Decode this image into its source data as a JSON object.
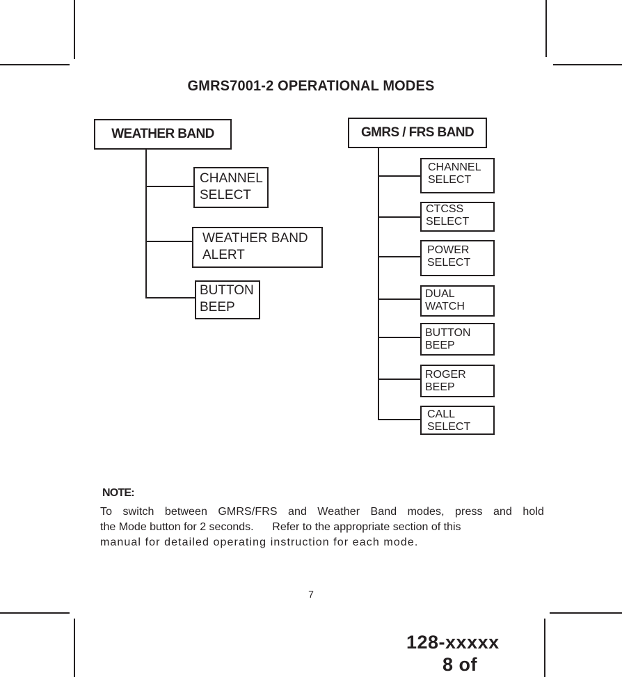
{
  "title": "GMRS7001-2 OPERATIONAL MODES",
  "weather_band": {
    "label": "WEATHER BAND",
    "children": [
      {
        "label": "CHANNEL\nSELECT"
      },
      {
        "label": "WEATHER BAND\nALERT"
      },
      {
        "label": "BUTTON\nBEEP"
      }
    ]
  },
  "gmrs_frs_band": {
    "label": "GMRS / FRS BAND",
    "children": [
      {
        "label": "CHANNEL\nSELECT"
      },
      {
        "label": "CTCSS\nSELECT"
      },
      {
        "label": "POWER\nSELECT"
      },
      {
        "label": "DUAL\nWATCH"
      },
      {
        "label": "BUTTON\nBEEP"
      },
      {
        "label": "ROGER\nBEEP"
      },
      {
        "label": "CALL\nSELECT"
      }
    ]
  },
  "note": {
    "heading": "NOTE:",
    "lines": [
      "To switch between GMRS/FRS and Weather Band modes, press and hold",
      "the Mode button for 2 seconds.      Refer to the appropriate section of this",
      "manual for detailed operating instruction for each mode."
    ]
  },
  "footer": {
    "page_number": "7",
    "doc_number": "128-xxxxx",
    "sheet": "8 of"
  }
}
